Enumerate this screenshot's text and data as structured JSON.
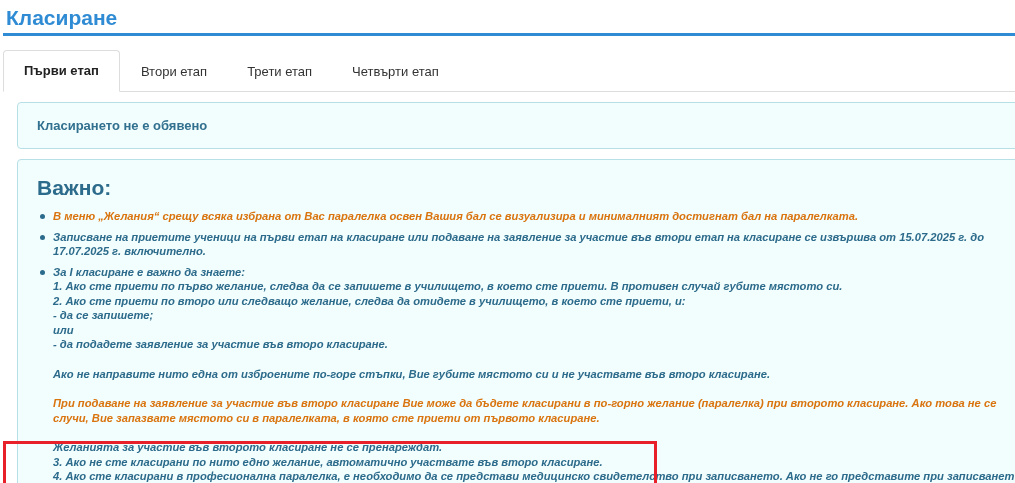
{
  "page_title": "Класиране",
  "tabs": [
    {
      "label": "Първи етап",
      "selected": true
    },
    {
      "label": "Втори етап",
      "selected": false
    },
    {
      "label": "Трети етап",
      "selected": false
    },
    {
      "label": "Четвърти етап",
      "selected": false
    }
  ],
  "status_message": "Класирането не е обявено",
  "notice": {
    "heading": "Важно:",
    "bullets": [
      {
        "paragraphs": [
          {
            "lines": [
              {
                "text": "В меню „Желания“ срещу всяка избрана от Вас паралелка освен Вашия бал се визуализира и минималният достигнат бал на паралелката.",
                "color": "#d9740f"
              }
            ]
          }
        ]
      },
      {
        "paragraphs": [
          {
            "lines": [
              {
                "text": "Записване на приетите ученици на първи етап на класиране или подаване на заявление за участие във втори етап на класиране се извършва от 15.07.2025 г. до",
                "color": "#2c6b8b"
              },
              {
                "text": "17.07.2025 г. включително.",
                "color": "#2c6b8b"
              }
            ]
          }
        ]
      },
      {
        "paragraphs": [
          {
            "lines": [
              {
                "text": "За I класиране е важно да знаете:",
                "color": "#2c6b8b"
              },
              {
                "text": "1. Ако сте приети по първо желание, следва да се запишете в училището, в което сте приети. В противен случай губите мястото си.",
                "color": "#2c6b8b"
              },
              {
                "text": "2. Ако сте приети по второ или следващо желание, следва да отидете в училището, в което сте приети, и:",
                "color": "#2c6b8b"
              },
              {
                "text": "- да се запишете;",
                "color": "#2c6b8b"
              },
              {
                "text": "или",
                "color": "#2c6b8b"
              },
              {
                "text": "- да подадете заявление за участие във второ класиране.",
                "color": "#2c6b8b"
              }
            ]
          },
          {
            "lines": [
              {
                "text": "Ако не направите нито една от изброените по-горе стъпки, Вие губите мястото си и не участвате във второ класиране.",
                "color": "#2c6b8b"
              }
            ]
          },
          {
            "lines": [
              {
                "text": "При подаване на заявление за участие във второ класиране Вие може да бъдете класирани в по-горно желание (паралелка) при второто класиране. Ако това не се",
                "color": "#d9740f"
              },
              {
                "text": "случи, Вие запазвате мястото си в паралелката, в която сте приети от първото класиране.",
                "color": "#d9740f"
              }
            ]
          },
          {
            "lines": [
              {
                "text": "Желанията за участие във второто класиране не се пренареждат.",
                "color": "#2c6b8b"
              },
              {
                "text": "3. Ако не сте класирани по нито едно желание, автоматично участвате във второ класиране.",
                "color": "#2c6b8b"
              },
              {
                "text": "4. Ако сте класирани в професионална паралелка, е необходимо да се представи медицинско свидетелство при записването. Ако не го представите при записванет",
                "color": "#2c6b8b"
              }
            ]
          }
        ]
      }
    ]
  }
}
